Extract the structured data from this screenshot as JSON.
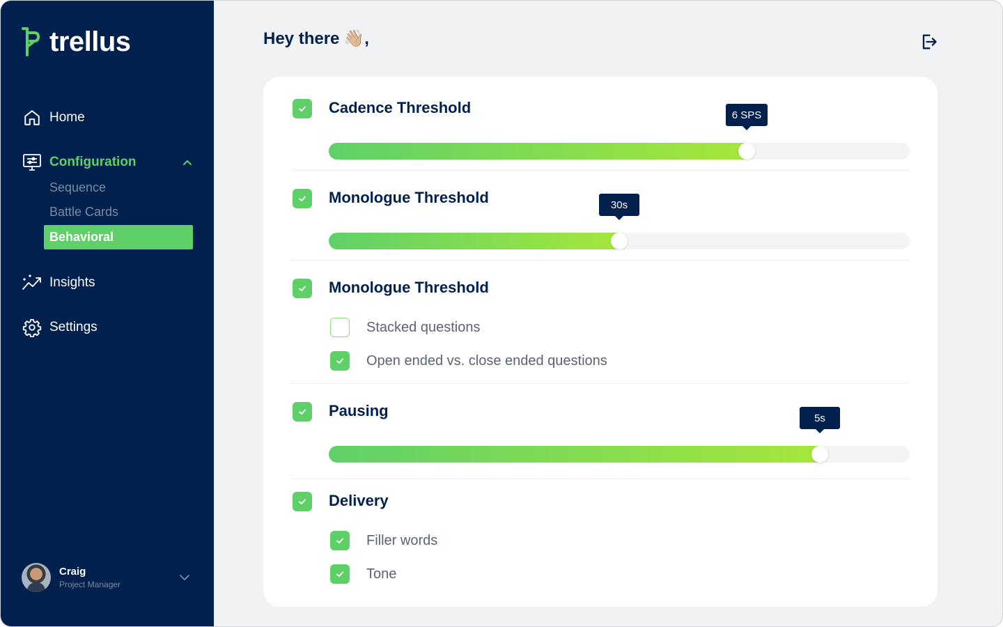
{
  "brand": {
    "name": "trellus"
  },
  "sidebar": {
    "nav": [
      {
        "label": "Home",
        "icon": "home-icon"
      },
      {
        "label": "Configuration",
        "icon": "monitor-sliders-icon",
        "active": true
      },
      {
        "label": "Insights",
        "icon": "chart-line-icon"
      },
      {
        "label": "Settings",
        "icon": "gear-icon"
      }
    ],
    "config_sub": [
      {
        "label": "Sequence"
      },
      {
        "label": "Battle Cards"
      },
      {
        "label": "Behavioral",
        "selected": true
      }
    ],
    "user": {
      "name": "Craig",
      "role": "Project Manager"
    }
  },
  "header": {
    "greeting": "Hey there",
    "emoji": "👋🏼",
    "punct": ","
  },
  "sections": [
    {
      "title": "Cadence Threshold",
      "checked": true,
      "slider": {
        "value_label": "6 SPS",
        "fraction": 0.72
      }
    },
    {
      "title": "Monologue Threshold",
      "checked": true,
      "slider": {
        "value_label": "30s",
        "fraction": 0.5
      }
    },
    {
      "title": "Monologue Threshold",
      "checked": true,
      "options": [
        {
          "label": "Stacked  questions",
          "checked": false
        },
        {
          "label": "Open ended vs. close ended questions",
          "checked": true
        }
      ]
    },
    {
      "title": "Pausing",
      "checked": true,
      "slider": {
        "value_label": "5s",
        "fraction": 0.845
      }
    },
    {
      "title": "Delivery",
      "checked": true,
      "options": [
        {
          "label": "Filler words",
          "checked": true
        },
        {
          "label": "Tone",
          "checked": true
        }
      ]
    }
  ],
  "colors": {
    "sidebar": "#01204d",
    "accent": "#5fd068",
    "accent_end": "#a7e73a",
    "background": "#f1f2f4"
  }
}
